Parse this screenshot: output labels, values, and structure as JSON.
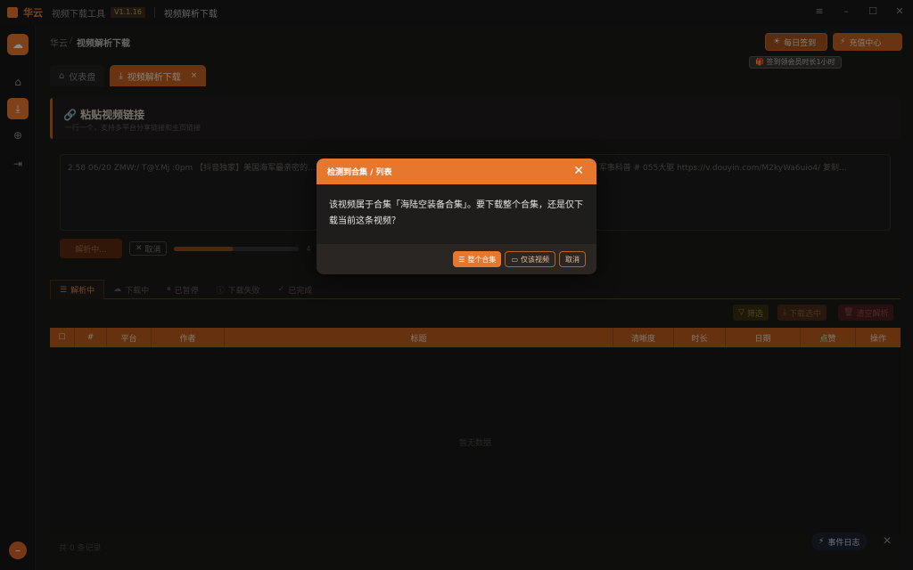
{
  "titlebar": {
    "app_name": "华云",
    "app_sub": "视频下载工具",
    "version": "V1.1.16",
    "page_title": "视频解析下载",
    "controls": [
      "≡",
      "–",
      "☐",
      "✕"
    ]
  },
  "sidebar": {
    "items": [
      {
        "name": "home",
        "icon": "⌂"
      },
      {
        "name": "download",
        "icon": "⤓"
      },
      {
        "name": "globe",
        "icon": "⊕"
      },
      {
        "name": "export",
        "icon": "⇥"
      }
    ]
  },
  "breadcrumb": {
    "root": "华云",
    "sep": "/",
    "current": "视频解析下载"
  },
  "header": {
    "checkin_label": "每日签到",
    "recharge_label": "充值中心",
    "tooltip": "签到领会员时长1小时"
  },
  "tabs": [
    {
      "label": "仪表盘",
      "icon": "⌂"
    },
    {
      "label": "视频解析下载",
      "icon": "⤓",
      "close": "×"
    }
  ],
  "panel": {
    "title": "粘贴视频链接",
    "subtitle": "一行一个，支持多平台分享链接和主页链接",
    "icon": "🔗"
  },
  "url_input": {
    "value": "2.58 06/20 ZMW:/ T@Y.Mj :0pm 【抖音独家】美国海军最亲密的...                                                                                       ? 还是50艘？ # 时代鸱鸮离岛出列 # 破壁深度计划 # 青年创作者成长计划 # 军事科普 # 055大驱  https://v.douyin.com/M2kyWa6uio4/ 复制..."
  },
  "parse": {
    "parse_label": "解析中...",
    "cancel_label": "取消",
    "progress": 0.47,
    "progress_text": "4"
  },
  "list_tabs": [
    {
      "label": "解析中",
      "icon": "☰"
    },
    {
      "label": "下载中",
      "icon": "☁"
    },
    {
      "label": "已暂停",
      "icon": "⏸"
    },
    {
      "label": "下载失败",
      "icon": "ⓘ"
    },
    {
      "label": "已完成",
      "icon": "✓"
    }
  ],
  "actions": {
    "filter": "筛选",
    "download_selected": "下载选中",
    "clear": "清空解析"
  },
  "table": {
    "columns": [
      "",
      "#",
      "平台",
      "作者",
      "标题",
      "清晰度",
      "时长",
      "日期",
      "点赞",
      "操作"
    ],
    "empty_text": "暂无数据",
    "count_text": "共 0 条记录"
  },
  "event_log": {
    "label": "事件日志",
    "close": "✕"
  },
  "modal": {
    "title": "检测到合集 / 列表",
    "body": "该视频属于合集「海陆空装备合集」。要下载整个合集，还是仅下载当前这条视频？",
    "btn_all": "整个合集",
    "btn_only": "仅该视频",
    "btn_cancel": "取消",
    "close": "✕"
  }
}
